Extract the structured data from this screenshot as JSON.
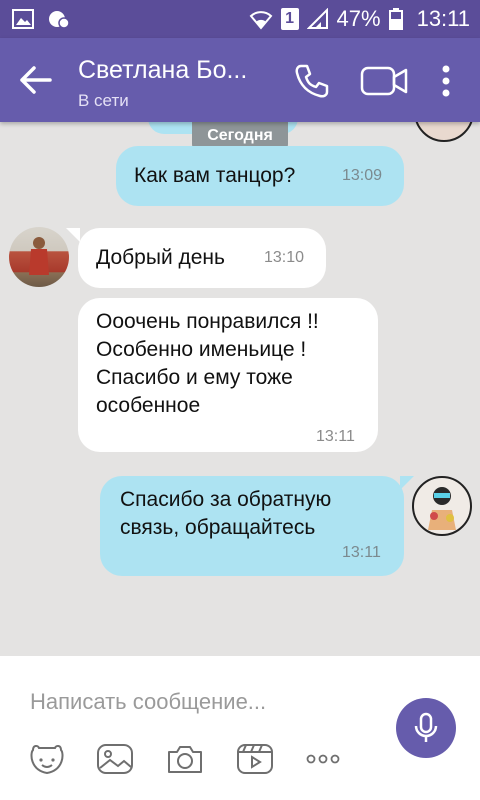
{
  "status_bar": {
    "battery": "47%",
    "time": "13:11",
    "sim_badge": "1",
    "icons": [
      "gallery-icon",
      "notification-icon",
      "wifi-icon",
      "signal-icon",
      "battery-icon"
    ]
  },
  "header": {
    "contact_name": "Светлана Бо...",
    "contact_status": "В сети",
    "icons": [
      "back-arrow-icon",
      "phone-icon",
      "video-camera-icon",
      "more-vert-icon"
    ]
  },
  "chat": {
    "date_separator": "Сегодня",
    "messages": [
      {
        "direction": "out",
        "lines": [
          "Как вам танцор?"
        ],
        "time": "13:09"
      },
      {
        "direction": "in",
        "lines": [
          "Добрый день"
        ],
        "time": "13:10"
      },
      {
        "direction": "in",
        "lines": [
          "Ооочень понравился !!",
          "Особенно именьице !",
          "Спасибо и ему тоже",
          "особенное"
        ],
        "time": "13:11"
      },
      {
        "direction": "out",
        "lines": [
          "Спасибо за обратную",
          "связь, обращайтесь"
        ],
        "time": "13:11"
      }
    ]
  },
  "composer": {
    "placeholder": "Написать сообщение...",
    "tools": [
      "sticker-icon",
      "gallery-icon",
      "camera-icon",
      "video-clip-icon",
      "more-icon"
    ]
  },
  "colors": {
    "accent": "#665cac",
    "status_bar": "#5b4d99",
    "outgoing_bubble": "#ade3f2",
    "incoming_bubble": "#ffffff",
    "chat_background": "#e4e3e2"
  }
}
